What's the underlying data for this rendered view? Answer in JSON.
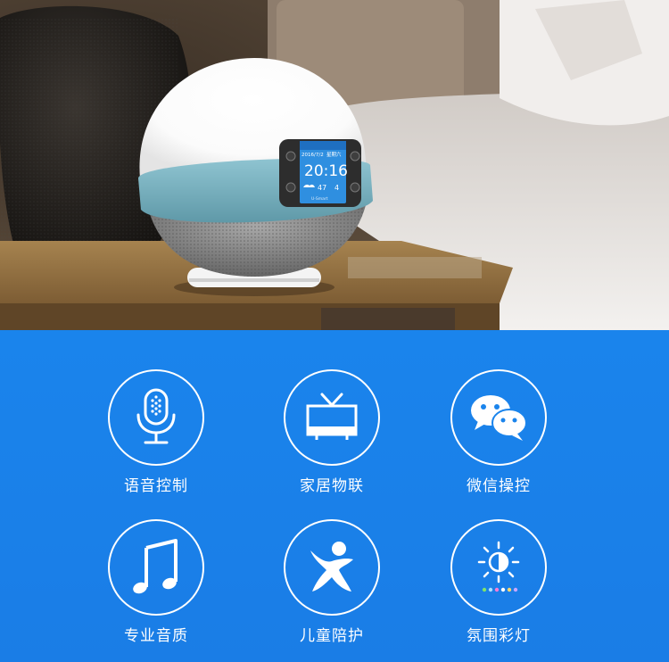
{
  "device_screen": {
    "date": "2016/7/2",
    "weekday": "星期六",
    "time": "20:16",
    "reading_left": "47",
    "reading_right": "4",
    "footer": "U-Smart"
  },
  "features": [
    {
      "label": "语音控制",
      "icon": "microphone-icon"
    },
    {
      "label": "家居物联",
      "icon": "tv-icon"
    },
    {
      "label": "微信操控",
      "icon": "wechat-icon"
    },
    {
      "label": "专业音质",
      "icon": "music-note-icon"
    },
    {
      "label": "儿童陪护",
      "icon": "child-figure-icon"
    },
    {
      "label": "氛围彩灯",
      "icon": "light-icon"
    }
  ],
  "colors": {
    "panel_blue": "#1a84ec",
    "device_band": "#7fb8c6",
    "screen_blue": "#2f8fe0"
  }
}
